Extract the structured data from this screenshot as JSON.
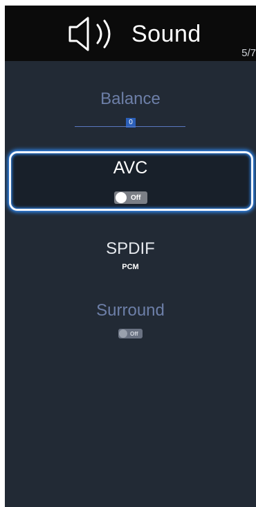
{
  "header": {
    "title": "Sound",
    "icon": "speaker-icon",
    "page_counter": "5/7"
  },
  "items": {
    "balance": {
      "label": "Balance",
      "value": "0"
    },
    "avc": {
      "label": "AVC",
      "toggle_text": "Off",
      "state": "off"
    },
    "spdif": {
      "label": "SPDIF",
      "value": "PCM"
    },
    "surround": {
      "label": "Surround",
      "toggle_text": "Off",
      "state": "off"
    }
  },
  "colors": {
    "background": "#222a35",
    "header": "#0b0b0b",
    "focus_glow": "#2f8fff",
    "dim_label": "#6d7fa8"
  }
}
